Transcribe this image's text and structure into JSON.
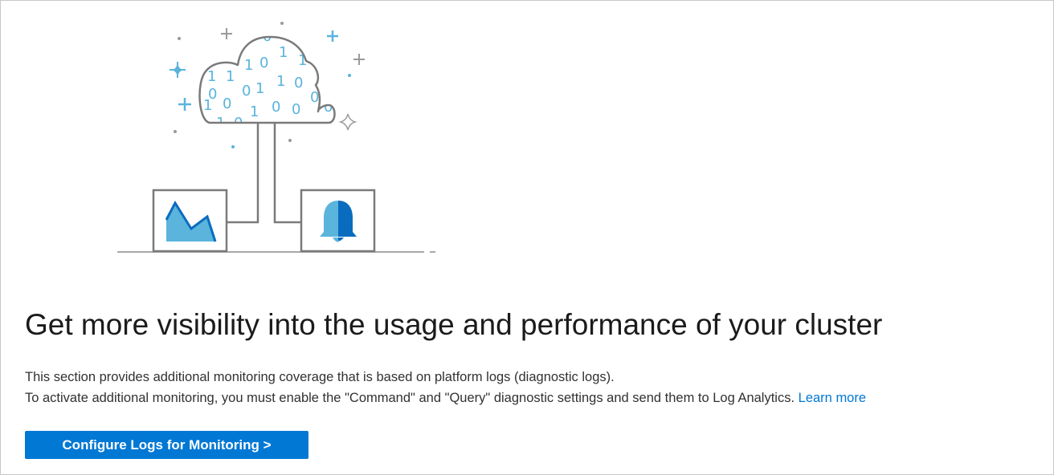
{
  "hero": {
    "title": "Get more visibility into the usage and performance of your cluster",
    "description_line1": "This section provides additional monitoring coverage that is based on platform logs (diagnostic logs).",
    "description_line2": "To activate additional monitoring, you must enable the \"Command\" and \"Query\" diagnostic settings and send them to Log Analytics.",
    "learn_more_label": "Learn more",
    "cta_label": "Configure Logs for Monitoring >"
  },
  "illustration": {
    "cloud_bits": [
      "1",
      "0",
      "1",
      "1",
      "0",
      "1",
      "0",
      "0",
      "1",
      "1",
      "0",
      "1",
      "0",
      "0",
      "0",
      "1",
      "0",
      "0",
      "1",
      "0",
      "0",
      "1",
      "0"
    ],
    "icons": [
      "cloud-icon",
      "area-chart-icon",
      "bell-icon",
      "sparkle-icon"
    ]
  },
  "colors": {
    "accent": "#0078d4",
    "illustration_light_blue": "#5ab4dc",
    "illustration_dark_blue": "#0a6cbf",
    "line_gray": "#7a7a7a"
  }
}
